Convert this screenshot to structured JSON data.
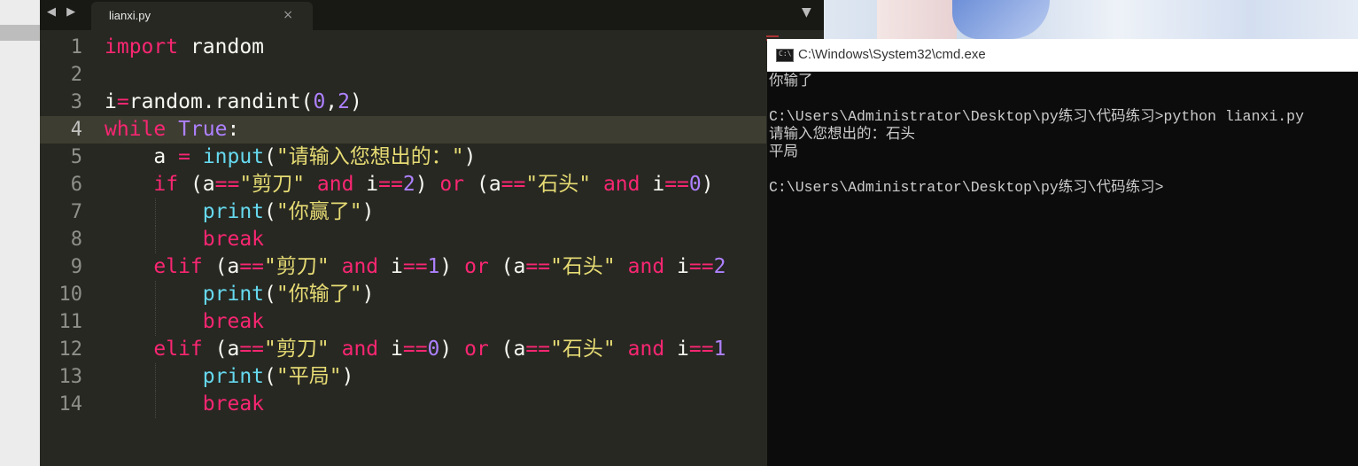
{
  "editor": {
    "nav_arrows": "◀ ▶",
    "tab_title": "lianxi.py",
    "tab_close": "×",
    "dropdown": "▼",
    "active_line": 4,
    "lines": [
      {
        "num": "1",
        "tokens": [
          [
            "kw",
            "import"
          ],
          [
            "pl",
            " random"
          ]
        ]
      },
      {
        "num": "2",
        "tokens": []
      },
      {
        "num": "3",
        "tokens": [
          [
            "pl",
            "i"
          ],
          [
            "op",
            "="
          ],
          [
            "pl",
            "random.randint("
          ],
          [
            "cn",
            "0"
          ],
          [
            "pl",
            ","
          ],
          [
            "cn",
            "2"
          ],
          [
            "pl",
            ")"
          ]
        ]
      },
      {
        "num": "4",
        "tokens": [
          [
            "kw",
            "while"
          ],
          [
            "pl",
            " "
          ],
          [
            "cn",
            "True"
          ],
          [
            "pl",
            ":"
          ]
        ]
      },
      {
        "num": "5",
        "tokens": [
          [
            "pl",
            "    a "
          ],
          [
            "op",
            "="
          ],
          [
            "pl",
            " "
          ],
          [
            "bt",
            "input"
          ],
          [
            "pl",
            "("
          ],
          [
            "st",
            "\"请输入您想出的：\""
          ],
          [
            "pl",
            ")"
          ]
        ]
      },
      {
        "num": "6",
        "tokens": [
          [
            "pl",
            "    "
          ],
          [
            "kw",
            "if"
          ],
          [
            "pl",
            " (a"
          ],
          [
            "op",
            "=="
          ],
          [
            "st",
            "\"剪刀\""
          ],
          [
            "pl",
            " "
          ],
          [
            "kw",
            "and"
          ],
          [
            "pl",
            " i"
          ],
          [
            "op",
            "=="
          ],
          [
            "cn",
            "2"
          ],
          [
            "pl",
            ") "
          ],
          [
            "kw",
            "or"
          ],
          [
            "pl",
            " (a"
          ],
          [
            "op",
            "=="
          ],
          [
            "st",
            "\"石头\""
          ],
          [
            "pl",
            " "
          ],
          [
            "kw",
            "and"
          ],
          [
            "pl",
            " i"
          ],
          [
            "op",
            "=="
          ],
          [
            "cn",
            "0"
          ],
          [
            "pl",
            ")"
          ]
        ]
      },
      {
        "num": "7",
        "tokens": [
          [
            "pl",
            "        "
          ],
          [
            "bt",
            "print"
          ],
          [
            "pl",
            "("
          ],
          [
            "st",
            "\"你赢了\""
          ],
          [
            "pl",
            ")"
          ]
        ]
      },
      {
        "num": "8",
        "tokens": [
          [
            "pl",
            "        "
          ],
          [
            "kw",
            "break"
          ]
        ]
      },
      {
        "num": "9",
        "tokens": [
          [
            "pl",
            "    "
          ],
          [
            "kw",
            "elif"
          ],
          [
            "pl",
            " (a"
          ],
          [
            "op",
            "=="
          ],
          [
            "st",
            "\"剪刀\""
          ],
          [
            "pl",
            " "
          ],
          [
            "kw",
            "and"
          ],
          [
            "pl",
            " i"
          ],
          [
            "op",
            "=="
          ],
          [
            "cn",
            "1"
          ],
          [
            "pl",
            ") "
          ],
          [
            "kw",
            "or"
          ],
          [
            "pl",
            " (a"
          ],
          [
            "op",
            "=="
          ],
          [
            "st",
            "\"石头\""
          ],
          [
            "pl",
            " "
          ],
          [
            "kw",
            "and"
          ],
          [
            "pl",
            " i"
          ],
          [
            "op",
            "=="
          ],
          [
            "cn",
            "2"
          ]
        ]
      },
      {
        "num": "10",
        "tokens": [
          [
            "pl",
            "        "
          ],
          [
            "bt",
            "print"
          ],
          [
            "pl",
            "("
          ],
          [
            "st",
            "\"你输了\""
          ],
          [
            "pl",
            ")"
          ]
        ]
      },
      {
        "num": "11",
        "tokens": [
          [
            "pl",
            "        "
          ],
          [
            "kw",
            "break"
          ]
        ]
      },
      {
        "num": "12",
        "tokens": [
          [
            "pl",
            "    "
          ],
          [
            "kw",
            "elif"
          ],
          [
            "pl",
            " (a"
          ],
          [
            "op",
            "=="
          ],
          [
            "st",
            "\"剪刀\""
          ],
          [
            "pl",
            " "
          ],
          [
            "kw",
            "and"
          ],
          [
            "pl",
            " i"
          ],
          [
            "op",
            "=="
          ],
          [
            "cn",
            "0"
          ],
          [
            "pl",
            ") "
          ],
          [
            "kw",
            "or"
          ],
          [
            "pl",
            " (a"
          ],
          [
            "op",
            "=="
          ],
          [
            "st",
            "\"石头\""
          ],
          [
            "pl",
            " "
          ],
          [
            "kw",
            "and"
          ],
          [
            "pl",
            " i"
          ],
          [
            "op",
            "=="
          ],
          [
            "cn",
            "1"
          ]
        ]
      },
      {
        "num": "13",
        "tokens": [
          [
            "pl",
            "        "
          ],
          [
            "bt",
            "print"
          ],
          [
            "pl",
            "("
          ],
          [
            "st",
            "\"平局\""
          ],
          [
            "pl",
            ")"
          ]
        ]
      },
      {
        "num": "14",
        "tokens": [
          [
            "pl",
            "        "
          ],
          [
            "kw",
            "break"
          ]
        ]
      }
    ]
  },
  "cmd": {
    "title": "C:\\Windows\\System32\\cmd.exe",
    "icon_text": "C:\\",
    "lines": [
      "你输了",
      "",
      "C:\\Users\\Administrator\\Desktop\\py练习\\代码练习>python lianxi.py",
      "请输入您想出的：石头",
      "平局",
      "",
      "C:\\Users\\Administrator\\Desktop\\py练习\\代码练习>"
    ]
  },
  "colors": {
    "keyword": "#f92672",
    "builtin": "#66d9ef",
    "constant": "#ae81ff",
    "string": "#e6db74",
    "editor_bg": "#272822",
    "cmd_bg": "#0c0c0c"
  }
}
